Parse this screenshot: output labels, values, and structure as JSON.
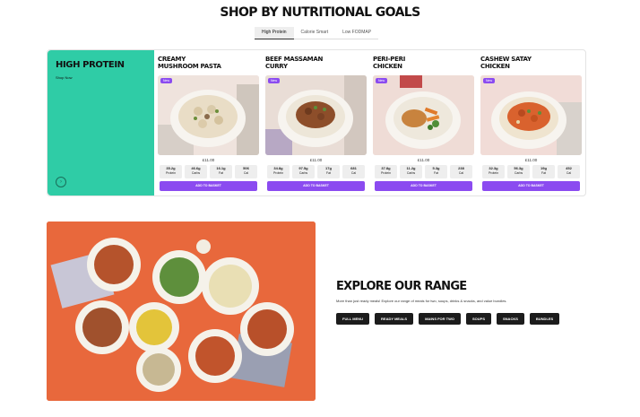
{
  "section_title": "SHOP BY NUTRITIONAL GOALS",
  "tabs": [
    {
      "label": "High Protein",
      "active": true
    },
    {
      "label": "Calorie Smart",
      "active": false
    },
    {
      "label": "Low FODMAP",
      "active": false
    }
  ],
  "hero": {
    "title": "HIGH PROTEIN",
    "link": "Shop Now",
    "arrow_icon": "chevron-right-icon",
    "bg_color": "#2fcca6"
  },
  "products": [
    {
      "name": "CREAMY\nMUSHROOM PASTA",
      "badge": "New",
      "price": "£11.00",
      "macros": [
        {
          "value": "35.2g",
          "label": "Protein"
        },
        {
          "value": "46.6g",
          "label": "Carbs"
        },
        {
          "value": "16.1g",
          "label": "Fat"
        },
        {
          "value": "506",
          "label": "Cal"
        }
      ],
      "button": "ADD TO BASKET"
    },
    {
      "name": "BEEF MASSAMAN\nCURRY",
      "badge": "New",
      "price": "£11.00",
      "macros": [
        {
          "value": "34.8g",
          "label": "Protein"
        },
        {
          "value": "97.5g",
          "label": "Carbs"
        },
        {
          "value": "17g",
          "label": "Fat"
        },
        {
          "value": "681",
          "label": "Cal"
        }
      ],
      "button": "ADD TO BASKET"
    },
    {
      "name": "PERI-PERI\nCHICKEN",
      "badge": "New",
      "price": "£11.00",
      "macros": [
        {
          "value": "37.8g",
          "label": "Protein"
        },
        {
          "value": "11.2g",
          "label": "Carbs"
        },
        {
          "value": "5.3g",
          "label": "Fat"
        },
        {
          "value": "238",
          "label": "Cal"
        }
      ],
      "button": "ADD TO BASKET"
    },
    {
      "name": "CASHEW SATAY\nCHICKEN",
      "badge": "New",
      "price": "£11.00",
      "macros": [
        {
          "value": "32.3g",
          "label": "Protein"
        },
        {
          "value": "56.3g",
          "label": "Carbs"
        },
        {
          "value": "19g",
          "label": "Fat"
        },
        {
          "value": "452",
          "label": "Cal"
        }
      ],
      "button": "ADD TO BASKET"
    }
  ],
  "explore": {
    "title": "EXPLORE OUR RANGE",
    "description": "More than just ready meals! Explore our range of meals for two, soups, drinks & snacks, and value bundles.",
    "chips": [
      "FULL MENU",
      "READY MEALS",
      "MAINS FOR TWO",
      "SOUPS",
      "SNACKS",
      "BUNDLES"
    ]
  },
  "colors": {
    "accent_purple": "#8b4bf0",
    "hero_green": "#2fcca6",
    "range_orange": "#e8683c",
    "chip_dark": "#1c1c1c"
  }
}
